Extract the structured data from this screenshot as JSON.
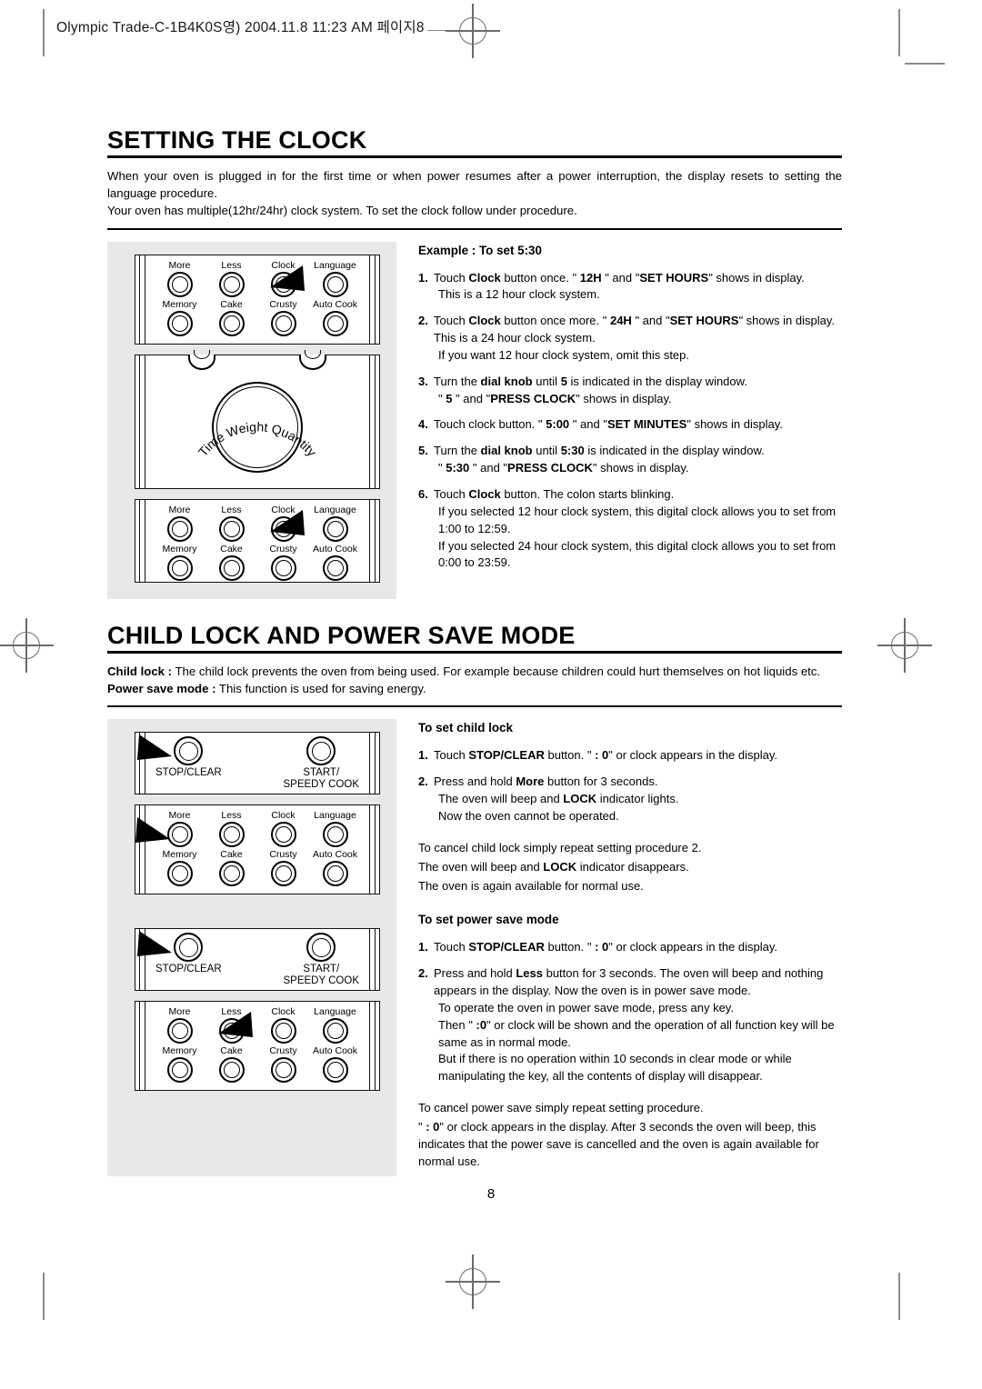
{
  "slug": "Olympic Trade-C-1B4K0S영)  2004.11.8 11:23 AM  페이지8",
  "page_number": "8",
  "sections": [
    {
      "title": "SETTING THE CLOCK",
      "intro": [
        "When your oven is plugged in for the first time or when power resumes after a power interruption, the display resets to setting the language procedure.",
        "Your oven has multiple(12hr/24hr) clock system.  To set the clock follow under procedure."
      ],
      "sub_head": "Example : To set 5:30",
      "steps": [
        {
          "num": "1.",
          "lines": [
            "Touch <b>Clock</b> button once. \" <b>12H</b> \" and \"<b>SET HOURS</b>\" shows in display.",
            "This is a 12 hour clock system."
          ]
        },
        {
          "num": "2.",
          "lines": [
            "Touch <b>Clock</b> button once more. \" <b>24H</b> \" and \"<b>SET HOURS</b>\" shows in display. This is a 24 hour clock system.",
            "If you want 12 hour clock system, omit this step."
          ]
        },
        {
          "num": "3.",
          "lines": [
            "Turn the <b>dial knob</b> until <b>5</b> is indicated in the display window.",
            "\" <b>5</b> \" and \"<b>PRESS CLOCK</b>\" shows in display."
          ]
        },
        {
          "num": "4.",
          "lines": [
            "Touch clock button. \" <b>5:00</b> \" and \"<b>SET MINUTES</b>\" shows in display."
          ]
        },
        {
          "num": "5.",
          "lines": [
            "Turn the <b>dial knob</b> until <b>5:30</b> is indicated in the display window.",
            "\" <b>5:30</b> \" and \"<b>PRESS CLOCK</b>\" shows in display."
          ]
        },
        {
          "num": "6.",
          "lines": [
            "Touch <b>Clock</b> button.  The colon starts blinking.",
            "If you selected 12 hour clock system, this digital clock allows you to set from 1:00 to 12:59.",
            "If you selected 24 hour clock system, this digital clock allows you to set from 0:00 to 23:59."
          ]
        }
      ]
    },
    {
      "title": "CHILD LOCK AND POWER SAVE MODE",
      "intro": [
        "<b>Child lock :</b> The child lock prevents the oven from being used.  For example because children could hurt themselves on hot liquids etc.",
        "<b>Power save mode :</b> This function is used for saving energy."
      ],
      "childlock": {
        "sub_head": "To set child lock",
        "steps": [
          {
            "num": "1.",
            "lines": [
              "Touch <b>STOP/CLEAR</b> button.  \" <b>: 0</b>\" or clock appears in the display."
            ]
          },
          {
            "num": "2.",
            "lines": [
              "Press and hold <b>More</b> button for 3 seconds.",
              "The oven will beep and <b>LOCK</b> indicator lights.",
              "Now the oven cannot be operated."
            ]
          }
        ],
        "notes": [
          "To cancel child lock simply repeat setting procedure 2.",
          "The oven will beep and <b>LOCK</b> indicator disappears.",
          "The oven is again available for normal use."
        ]
      },
      "powersave": {
        "sub_head": "To set power save mode",
        "steps": [
          {
            "num": "1.",
            "lines": [
              "Touch <b>STOP/CLEAR</b> button.  \" <b>: 0</b>\" or clock appears in the display."
            ]
          },
          {
            "num": "2.",
            "lines": [
              "Press and hold <b>Less</b> button for 3 seconds.  The oven will beep and nothing appears in the display.  Now the oven is in power save mode.",
              "To operate the oven in power save mode, press any key.",
              "Then \" <b>:0</b>\" or clock will be shown and the operation of all function key will be same as in normal mode.",
              "But if there is no operation within 10 seconds in clear mode or while manipulating the key, all the contents of display will disappear."
            ]
          }
        ],
        "notes": [
          "To cancel power save simply repeat setting procedure.",
          "\" <b>: 0</b>\" or clock appears in the display.  After 3 seconds the oven will beep, this indicates that the power save is cancelled and the oven is again available for normal use."
        ]
      }
    }
  ],
  "control_panel": {
    "dial_caption": "Time Weight Quantity",
    "keypad_labels_row1": [
      "More",
      "Less",
      "Clock",
      "Language"
    ],
    "keypad_labels_row2": [
      "Memory",
      "Cake",
      "Crusty",
      "Auto Cook"
    ],
    "stop_label": "STOP/CLEAR",
    "start_label": "START/\nSPEEDY COOK"
  },
  "figures": [
    {
      "type": "keypad",
      "arrow_target": "Clock"
    },
    {
      "type": "dial",
      "arrow_target": ""
    },
    {
      "type": "keypad",
      "arrow_target": "Clock"
    },
    {
      "type": "stopstart",
      "arrow_target": "STOP/CLEAR"
    },
    {
      "type": "keypad",
      "arrow_target": "More"
    },
    {
      "type": "stopstart",
      "arrow_target": "STOP/CLEAR"
    },
    {
      "type": "keypad",
      "arrow_target": "Less"
    }
  ],
  "colors": {
    "panel_bg": "#e8e8e8",
    "ink": "#000000",
    "regmark": "#6b6b6b"
  }
}
